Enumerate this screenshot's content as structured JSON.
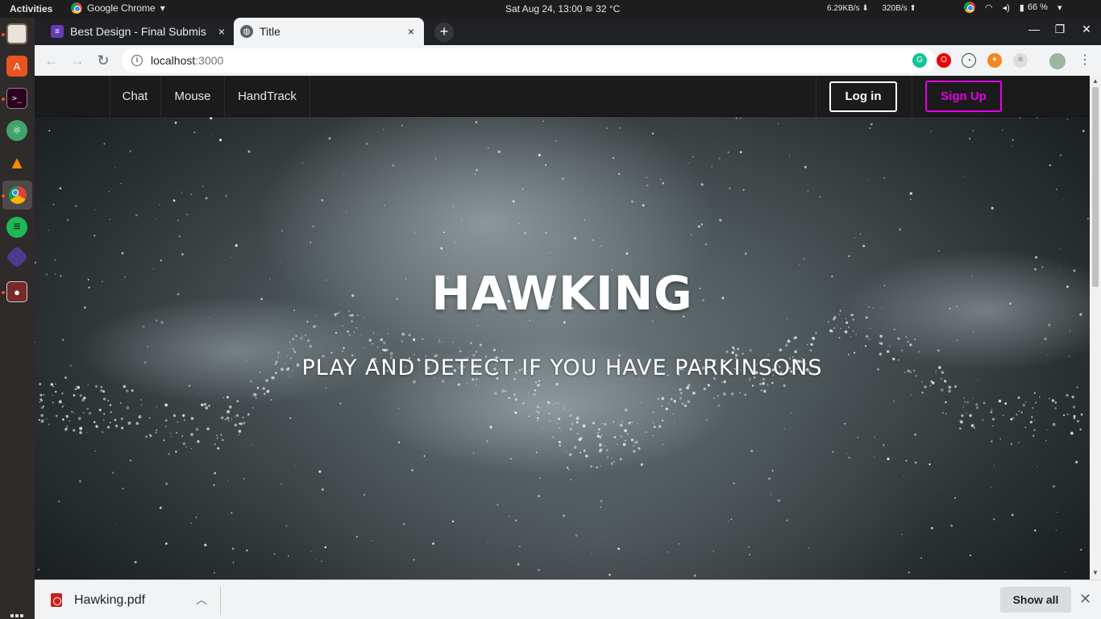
{
  "os_topbar": {
    "activities": "Activities",
    "app_name": "Google Chrome",
    "clock": "Sat Aug 24, 13:00",
    "weather": "32 °C",
    "net_down": "6.29KB/s",
    "net_up": "320B/s",
    "battery": "66 %"
  },
  "dock": {
    "items": [
      "files-icon",
      "software-center-icon",
      "terminal-icon",
      "atom-icon",
      "vlc-icon",
      "chrome-icon",
      "spotify-icon",
      "kdenlive-icon",
      "screen-recorder-icon"
    ]
  },
  "browser": {
    "tabs": [
      {
        "title": "Best Design - Final Submis",
        "close": "×"
      },
      {
        "title": "Title",
        "close": "×"
      }
    ],
    "new_tab": "+",
    "url_host": "localhost",
    "url_port": ":3000"
  },
  "page": {
    "nav_links": [
      "Chat",
      "Mouse",
      "HandTrack"
    ],
    "login_label": "Log in",
    "signup_label": "Sign Up",
    "hero_title": "HAWKING",
    "hero_subtitle": "PLAY AND DETECT IF YOU HAVE PARKINSONS",
    "accent_color": "#e600e6"
  },
  "downloads": {
    "file_name": "Hawking.pdf",
    "show_all": "Show all"
  }
}
